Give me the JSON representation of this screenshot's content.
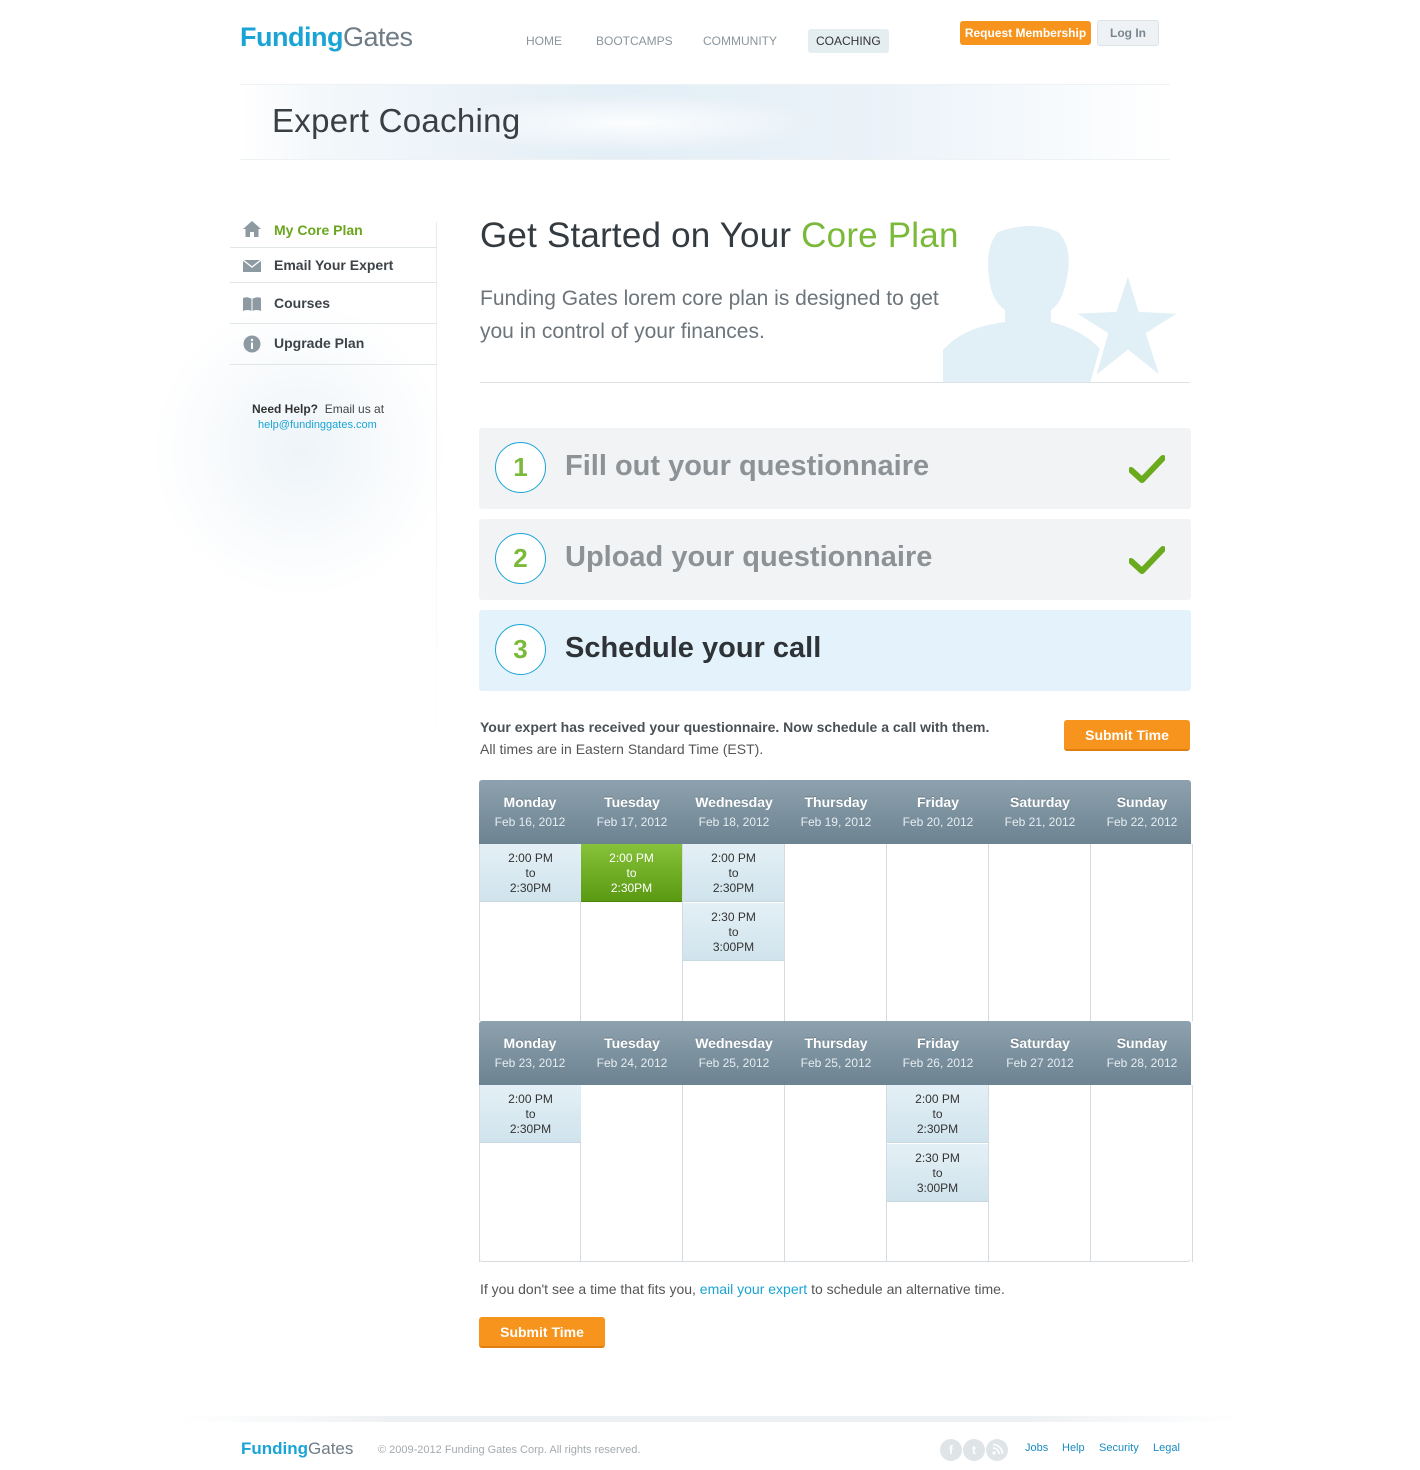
{
  "header": {
    "logo_part1": "Funding",
    "logo_part2": "Gates",
    "nav": [
      "HOME",
      "BOOTCAMPS",
      "COMMUNITY",
      "COACHING"
    ],
    "request_label": "Request Membership",
    "login_label": "Log In"
  },
  "banner": {
    "title": "Expert Coaching"
  },
  "sidebar": {
    "items": [
      {
        "label": "My Core Plan",
        "icon": "home-icon"
      },
      {
        "label": "Email Your Expert",
        "icon": "envelope-icon"
      },
      {
        "label": "Courses",
        "icon": "book-icon"
      },
      {
        "label": "Upgrade Plan",
        "icon": "info-icon"
      }
    ],
    "help_bold": "Need Help?",
    "help_text": "Email us at",
    "help_email": "help@fundinggates.com"
  },
  "main": {
    "title_part1": "Get Started on Your ",
    "title_part2": "Core Plan",
    "subtitle": "Funding Gates lorem core plan is designed to get you in control of your finances.",
    "steps": [
      {
        "number": "1",
        "label": "Fill out your questionnaire",
        "done": true
      },
      {
        "number": "2",
        "label": "Upload your questionnaire",
        "done": true
      },
      {
        "number": "3",
        "label": "Schedule your call",
        "done": false
      }
    ],
    "schedule_line1": "Your expert has received your questionnaire. Now schedule a call with them.",
    "schedule_line2": "All times are in Eastern Standard Time (EST).",
    "submit_label": "Submit Time",
    "alt_before": "If you don't see a time that fits you, ",
    "alt_link": "email your expert",
    "alt_after": " to schedule an alternative time."
  },
  "calendar": {
    "weeks": [
      {
        "days": [
          {
            "day": "Monday",
            "date": "Feb 16, 2012",
            "slots": [
              {
                "from": "2:00 PM",
                "to": "to",
                "end": "2:30PM",
                "selected": false
              }
            ]
          },
          {
            "day": "Tuesday",
            "date": "Feb 17, 2012",
            "slots": [
              {
                "from": "2:00 PM",
                "to": "to",
                "end": "2:30PM",
                "selected": true
              }
            ]
          },
          {
            "day": "Wednesday",
            "date": "Feb 18, 2012",
            "slots": [
              {
                "from": "2:00 PM",
                "to": "to",
                "end": "2:30PM",
                "selected": false
              },
              {
                "from": "2:30 PM",
                "to": "to",
                "end": "3:00PM",
                "selected": false
              }
            ]
          },
          {
            "day": "Thursday",
            "date": "Feb 19, 2012",
            "slots": []
          },
          {
            "day": "Friday",
            "date": "Feb 20, 2012",
            "slots": []
          },
          {
            "day": "Saturday",
            "date": "Feb 21, 2012",
            "slots": []
          },
          {
            "day": "Sunday",
            "date": "Feb 22, 2012",
            "slots": []
          }
        ]
      },
      {
        "days": [
          {
            "day": "Monday",
            "date": "Feb 23, 2012",
            "slots": [
              {
                "from": "2:00 PM",
                "to": "to",
                "end": "2:30PM",
                "selected": false
              }
            ]
          },
          {
            "day": "Tuesday",
            "date": "Feb 24, 2012",
            "slots": []
          },
          {
            "day": "Wednesday",
            "date": "Feb 25, 2012",
            "slots": []
          },
          {
            "day": "Thursday",
            "date": "Feb 25, 2012",
            "slots": []
          },
          {
            "day": "Friday",
            "date": "Feb 26, 2012",
            "slots": [
              {
                "from": "2:00 PM",
                "to": "to",
                "end": "2:30PM",
                "selected": false
              },
              {
                "from": "2:30 PM",
                "to": "to",
                "end": "3:00PM",
                "selected": false
              }
            ]
          },
          {
            "day": "Saturday",
            "date": "Feb 27 2012",
            "slots": []
          },
          {
            "day": "Sunday",
            "date": "Feb 28, 2012",
            "slots": []
          }
        ]
      }
    ]
  },
  "footer": {
    "logo_part1": "Funding",
    "logo_part2": "Gates",
    "copyright": "© 2009-2012 Funding Gates Corp. All rights reserved.",
    "social": [
      "facebook-icon",
      "twitter-icon",
      "rss-icon"
    ],
    "links": [
      "Jobs",
      "Help",
      "Security",
      "Legal"
    ]
  },
  "colors": {
    "brand_blue": "#1aa4d6",
    "accent_orange": "#f7941e",
    "accent_green": "#7bb93b",
    "selected_slot": "#6aab1e"
  }
}
